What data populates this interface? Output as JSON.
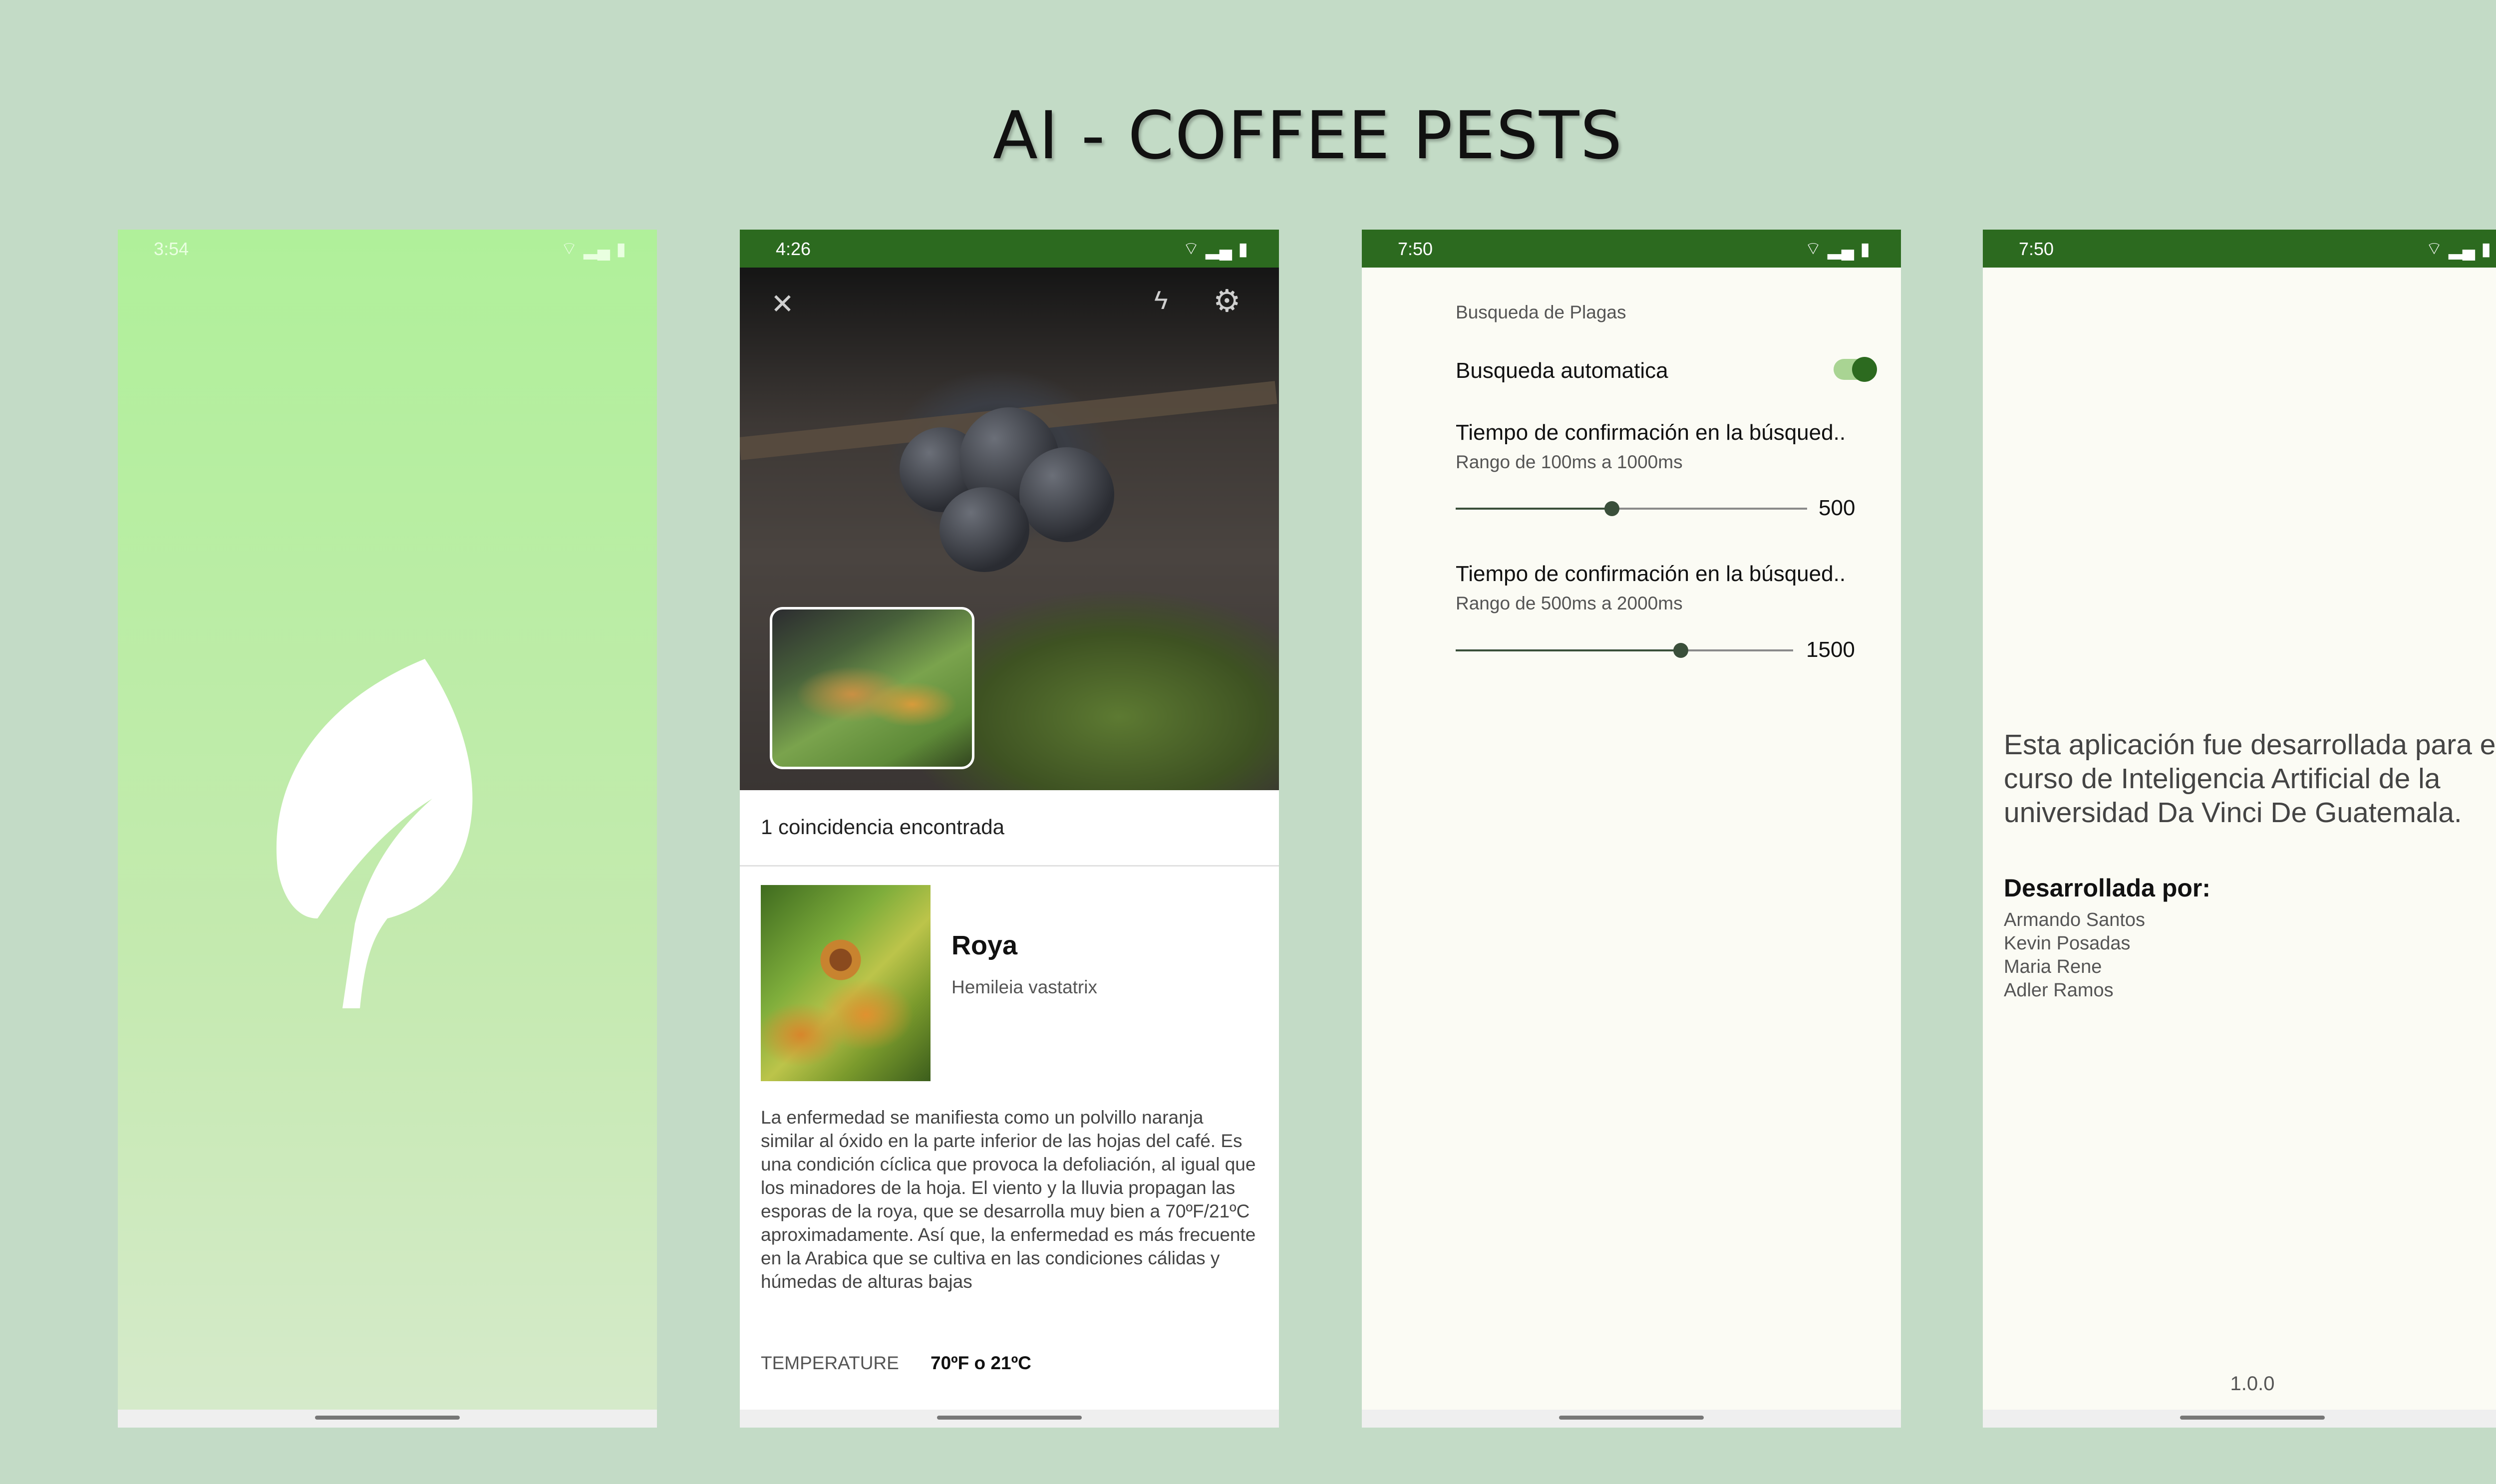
{
  "title": "AI - COFFEE PESTS",
  "colors": {
    "background": "#c3dbc6",
    "status_bar": "#2c6a1f",
    "accent": "#2c6a1f",
    "splash_gradient_top": "#b0f09a"
  },
  "screens": {
    "splash": {
      "time": "3:54",
      "icon": "leaf-icon"
    },
    "camera": {
      "time": "4:26",
      "match_text": "1 coincidencia encontrada",
      "pest": {
        "name": "Roya",
        "scientific_name": "Hemileia vastatrix",
        "description": "La enfermedad se manifiesta como un polvillo naranja similar al óxido en la parte inferior de las hojas del café. Es una condición cíclica que provoca la defoliación, al igual que los minadores de la hoja. El viento y la lluvia propagan las esporas de la roya, que se desarrolla muy bien a 70ºF/21ºC aproximadamente. Así que, la enfermedad es más frecuente en la Arabica que se cultiva en las condiciones cálidas y húmedas de alturas bajas",
        "temperature_label": "TEMPERATURE",
        "temperature_value": "70ºF o 21ºC"
      }
    },
    "settings": {
      "time": "7:50",
      "section": "Busqueda de Plagas",
      "auto_search": {
        "label": "Busqueda automatica",
        "enabled": true
      },
      "slider1": {
        "title": "Tiempo de confirmación en la búsqued..",
        "subtitle": "Rango de 100ms a 1000ms",
        "value": "500",
        "min": 100,
        "max": 1000
      },
      "slider2": {
        "title": "Tiempo de confirmación en la búsqued..",
        "subtitle": "Rango de 500ms a 2000ms",
        "value": "1500",
        "min": 500,
        "max": 2000
      }
    },
    "about": {
      "time": "7:50",
      "text": "Esta aplicación fue desarrollada para el curso de Inteligencia Artificial de la universidad Da Vinci De Guatemala.",
      "developed_by": "Desarrollada por:",
      "developers": [
        "Armando Santos",
        "Kevin Posadas",
        "Maria Rene",
        "Adler Ramos"
      ],
      "version": "1.0.0"
    }
  }
}
